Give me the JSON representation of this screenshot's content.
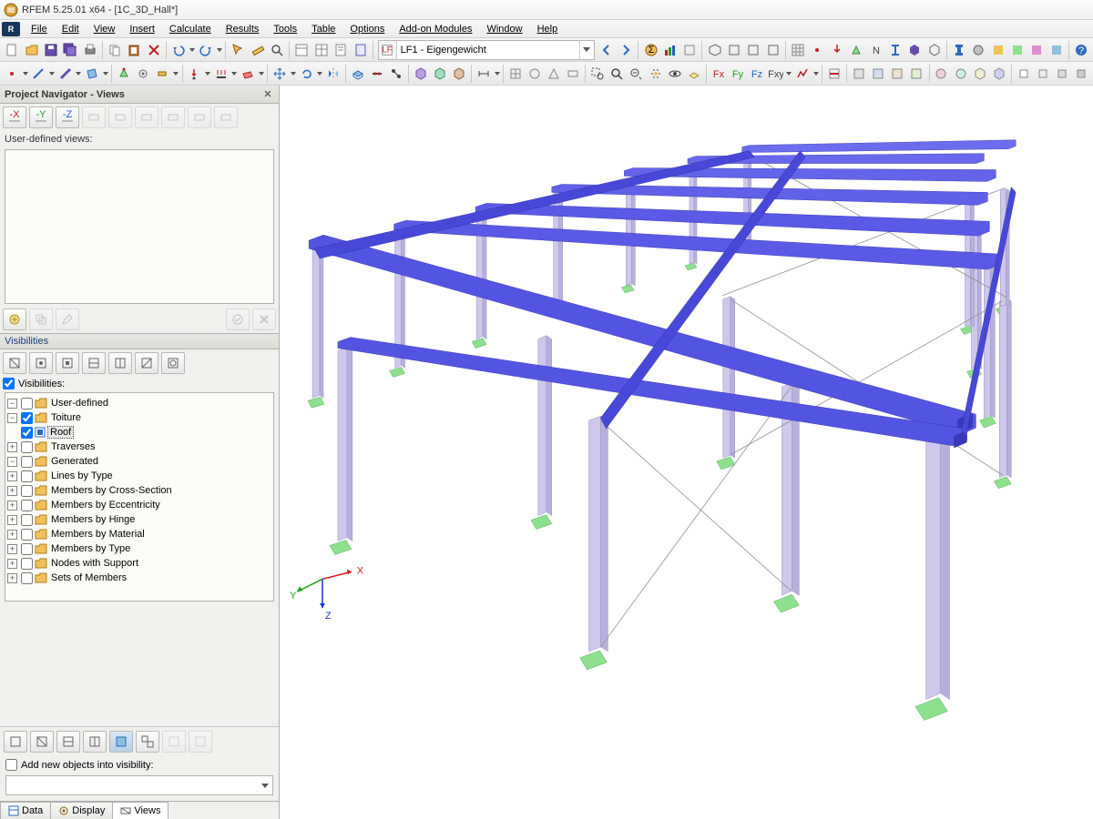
{
  "titlebar": {
    "text": "RFEM 5.25.01 x64 - [1C_3D_Hall*]"
  },
  "menu": {
    "items": [
      "File",
      "Edit",
      "View",
      "Insert",
      "Calculate",
      "Results",
      "Tools",
      "Table",
      "Options",
      "Add-on Modules",
      "Window",
      "Help"
    ]
  },
  "loadcase": {
    "value": "LF1 - Eigengewicht"
  },
  "navigator": {
    "title": "Project Navigator - Views",
    "user_views_label": "User-defined views:",
    "visibilities_title": "Visibilities",
    "visibilities_checkbox": "Visibilities:",
    "add_new_label": "Add new objects into visibility:",
    "tree": {
      "user_defined": "User-defined",
      "toiture": "Toiture",
      "roof": "Roof",
      "traverses": "Traverses",
      "generated": "Generated",
      "items": [
        "Lines by Type",
        "Members by Cross-Section",
        "Members by Eccentricity",
        "Members by Hinge",
        "Members by Material",
        "Members by Type",
        "Nodes with Support",
        "Sets of Members"
      ]
    },
    "tabs": {
      "data": "Data",
      "display": "Display",
      "views": "Views"
    }
  },
  "axes": {
    "x": "X",
    "y": "Y",
    "z": "Z"
  },
  "colors": {
    "beam": "#4a4ae0",
    "beam_dark": "#2e2ea8",
    "column": "#c7c2e8",
    "column_edge": "#8e88c0",
    "support": "#8de08d",
    "brace": "#999999"
  }
}
